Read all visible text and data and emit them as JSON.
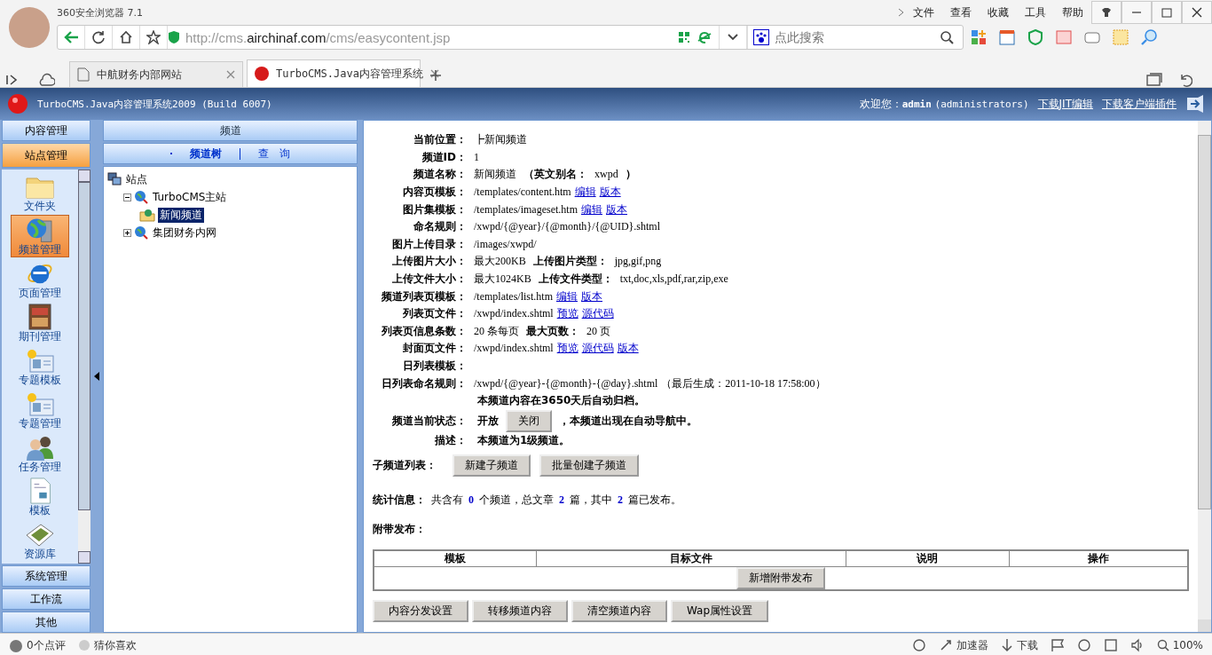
{
  "browser": {
    "title": "360安全浏览器 7.1",
    "menu": [
      "文件",
      "查看",
      "收藏",
      "工具",
      "帮助"
    ],
    "url": {
      "prefix": "http://cms.",
      "domain": "airchinaf.com",
      "path": "/cms/easycontent.jsp"
    },
    "search": {
      "placeholder": "点此搜索"
    },
    "tabs": [
      {
        "label": "中航财务内部网站",
        "selected": false
      },
      {
        "label": "TurboCMS.Java内容管理系统",
        "selected": true
      }
    ]
  },
  "app_header": {
    "title": "TurboCMS.Java内容管理系统2009 (Build 6007)",
    "welcome": "欢迎您：",
    "user": "admin",
    "role": "(administrators)",
    "links": [
      "下载JIT编辑",
      "下载客户端插件"
    ]
  },
  "sidebar": {
    "top_sections": [
      {
        "label": "内容管理",
        "selected": false
      },
      {
        "label": "站点管理",
        "selected": true
      }
    ],
    "items": [
      {
        "label": "文件夹",
        "kind": "folder",
        "selected": false
      },
      {
        "label": "频道管理",
        "kind": "globe-server",
        "selected": true
      },
      {
        "label": "页面管理",
        "kind": "browser",
        "selected": false
      },
      {
        "label": "期刊管理",
        "kind": "magazine",
        "selected": false
      },
      {
        "label": "专题模板",
        "kind": "card",
        "selected": false
      },
      {
        "label": "专题管理",
        "kind": "card",
        "selected": false
      },
      {
        "label": "任务管理",
        "kind": "people",
        "selected": false
      },
      {
        "label": "模板",
        "kind": "document",
        "selected": false
      },
      {
        "label": "资源库",
        "kind": "photos",
        "selected": false
      }
    ],
    "bottom_sections": [
      {
        "label": "系统管理",
        "selected": false
      },
      {
        "label": "工作流",
        "selected": false
      },
      {
        "label": "其他",
        "selected": false
      }
    ]
  },
  "tree_panel": {
    "title": "频道",
    "tabs": [
      {
        "label": "频道树",
        "selected": true
      },
      {
        "label": "查　询",
        "selected": false
      }
    ],
    "tree": [
      {
        "label": "站点",
        "kind": "root",
        "selected": false,
        "children": [
          {
            "label": "TurboCMS主站",
            "kind": "site",
            "expanded": true,
            "selected": false,
            "children": [
              {
                "label": "新闻频道",
                "kind": "channel",
                "selected": true
              }
            ]
          },
          {
            "label": "集团财务内网",
            "kind": "site",
            "expanded": false,
            "selected": false
          }
        ]
      }
    ]
  },
  "details": {
    "rows": [
      {
        "label": "当前位置：",
        "segments": [
          {
            "kind": "text",
            "text": "┣新闻频道"
          }
        ]
      },
      {
        "label": "频道ID：",
        "segments": [
          {
            "kind": "text",
            "text": "1"
          }
        ]
      },
      {
        "label": "频道名称：",
        "segments": [
          {
            "kind": "text",
            "text": "新闻频道"
          },
          {
            "kind": "strong",
            "text": "（英文别名："
          },
          {
            "kind": "text",
            "text": "xwpd"
          },
          {
            "kind": "strong",
            "text": "）"
          }
        ]
      },
      {
        "label": "内容页模板：",
        "segments": [
          {
            "kind": "text",
            "text": "/templates/content.htm"
          },
          {
            "kind": "link",
            "text": "编辑"
          },
          {
            "kind": "link",
            "text": "版本"
          }
        ]
      },
      {
        "label": "图片集模板：",
        "segments": [
          {
            "kind": "text",
            "text": "/templates/imageset.htm"
          },
          {
            "kind": "link",
            "text": "编辑"
          },
          {
            "kind": "link",
            "text": "版本"
          }
        ]
      },
      {
        "label": "命名规则：",
        "segments": [
          {
            "kind": "text",
            "text": "/xwpd/{@year}/{@month}/{@UID}.shtml"
          }
        ]
      },
      {
        "label": "图片上传目录：",
        "segments": [
          {
            "kind": "text",
            "text": "/images/xwpd/"
          }
        ]
      },
      {
        "label": "上传图片大小：",
        "segments": [
          {
            "kind": "text",
            "text": "最大200KB"
          },
          {
            "kind": "strong",
            "text": "上传图片类型："
          },
          {
            "kind": "text",
            "text": "jpg,gif,png"
          }
        ]
      },
      {
        "label": "上传文件大小：",
        "segments": [
          {
            "kind": "text",
            "text": "最大1024KB"
          },
          {
            "kind": "strong",
            "text": "上传文件类型："
          },
          {
            "kind": "text",
            "text": "txt,doc,xls,pdf,rar,zip,exe"
          }
        ]
      },
      {
        "label": "频道列表页模板：",
        "segments": [
          {
            "kind": "text",
            "text": "/templates/list.htm"
          },
          {
            "kind": "link",
            "text": "编辑"
          },
          {
            "kind": "link",
            "text": "版本"
          }
        ]
      },
      {
        "label": "列表页文件：",
        "segments": [
          {
            "kind": "text",
            "text": "/xwpd/index.shtml"
          },
          {
            "kind": "link",
            "text": "预览"
          },
          {
            "kind": "link",
            "text": "源代码"
          }
        ]
      },
      {
        "label": "列表页信息条数：",
        "segments": [
          {
            "kind": "text",
            "text": "20 条每页"
          },
          {
            "kind": "strong",
            "text": "最大页数："
          },
          {
            "kind": "text",
            "text": "20 页"
          }
        ]
      },
      {
        "label": "封面页文件：",
        "segments": [
          {
            "kind": "text",
            "text": "/xwpd/index.shtml"
          },
          {
            "kind": "link",
            "text": "预览"
          },
          {
            "kind": "link",
            "text": "源代码"
          },
          {
            "kind": "link",
            "text": "版本"
          }
        ]
      },
      {
        "label": "日列表模板："
      },
      {
        "label": "日列表命名规则：",
        "segments": [
          {
            "kind": "text",
            "text": "/xwpd/{@year}-{@month}-{@day}.shtml"
          },
          {
            "kind": "text",
            "text": "（最后生成：2011-10-18 17:58:00）"
          }
        ]
      },
      {
        "segments": [
          {
            "kind": "strong",
            "text": "本频道内容在3650天后自动归档。"
          }
        ]
      },
      {
        "label": "频道当前状态：",
        "segments": [
          {
            "kind": "strong",
            "text": "开放"
          },
          {
            "kind": "button",
            "text": "关闭"
          },
          {
            "kind": "strong",
            "text": "，本频道出现在自动导航中。"
          }
        ]
      },
      {
        "label": "描述：",
        "segments": [
          {
            "kind": "strong",
            "text": "本频道为1级频道。"
          }
        ]
      }
    ],
    "subchannels": {
      "label": "子频道列表：",
      "buttons": [
        "新建子频道",
        "批量创建子频道"
      ]
    },
    "stats": {
      "label": "统计信息：",
      "segments": [
        {
          "kind": "text",
          "text": "共含有"
        },
        {
          "kind": "number",
          "text": "0"
        },
        {
          "kind": "text",
          "text": "个频道，总文章"
        },
        {
          "kind": "number",
          "text": "2"
        },
        {
          "kind": "text",
          "text": "篇，其中"
        },
        {
          "kind": "number",
          "text": "2"
        },
        {
          "kind": "text",
          "text": "篇已发布。"
        }
      ]
    },
    "attached": {
      "label": "附带发布：",
      "columns": [
        "模板",
        "目标文件",
        "说明",
        "操作"
      ],
      "add_button": "新增附带发布"
    },
    "bottom_buttons": [
      "内容分发设置",
      "转移频道内容",
      "清空频道内容",
      "Wap属性设置"
    ]
  },
  "status_bar": {
    "left": [
      "0个点评",
      "猜你喜欢"
    ],
    "accelerator": "加速器",
    "download": "下载",
    "zoom": "100%"
  }
}
